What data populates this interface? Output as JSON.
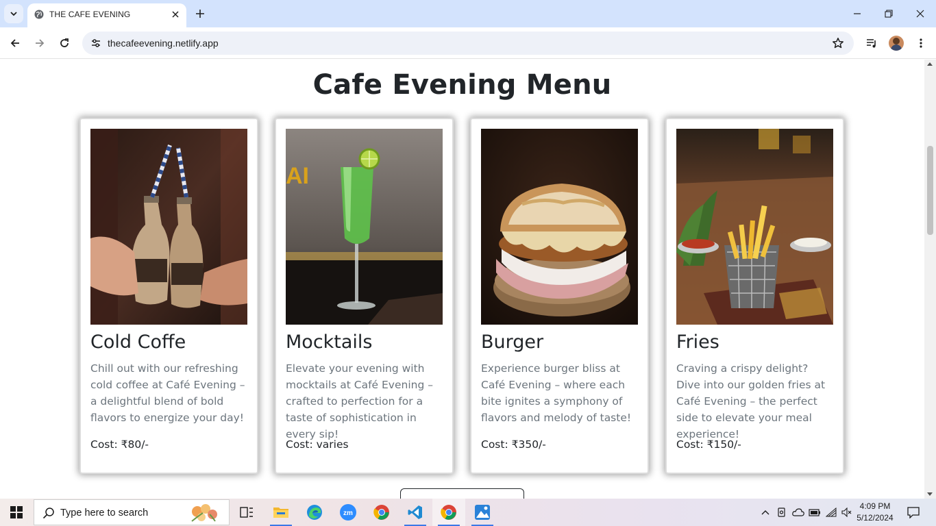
{
  "browser": {
    "tab_title": "THE CAFE EVENING",
    "url": "thecafeevening.netlify.app"
  },
  "page": {
    "title": "Cafe Evening Menu",
    "items": [
      {
        "name": "Cold Coffe",
        "description": "Chill out with our refreshing cold coffee at Café Evening – a delightful blend of bold flavors to energize your day!",
        "cost": "Cost: ₹80/-",
        "image": "cold-coffee-bottles-photo"
      },
      {
        "name": "Mocktails",
        "description": "Elevate your evening with mocktails at Café Evening – crafted to perfection for a taste of sophistication in every sip!",
        "cost": "Cost: varies",
        "image": "green-mocktail-glass-photo"
      },
      {
        "name": "Burger",
        "description": "Experience burger bliss at Café Evening – where each bite ignites a symphony of flavors and melody of taste!",
        "cost": "Cost: ₹350/-",
        "image": "cheese-burger-photo"
      },
      {
        "name": "Fries",
        "description": "Craving a crispy delight? Dive into our golden fries at Café Evening – the perfect side to elevate your meal experience!",
        "cost": "Cost: ₹150/-",
        "image": "fries-basket-photo"
      }
    ]
  },
  "taskbar": {
    "search_placeholder": "Type here to search",
    "time": "4:09 PM",
    "date": "5/12/2024",
    "apps": [
      "task-view",
      "file-explorer",
      "edge",
      "zoom",
      "chrome",
      "vscode",
      "chrome-active",
      "photos"
    ]
  },
  "colors": {
    "tabstrip": "#d3e3fd",
    "heading": "#212529",
    "muted_text": "#6c757d"
  }
}
